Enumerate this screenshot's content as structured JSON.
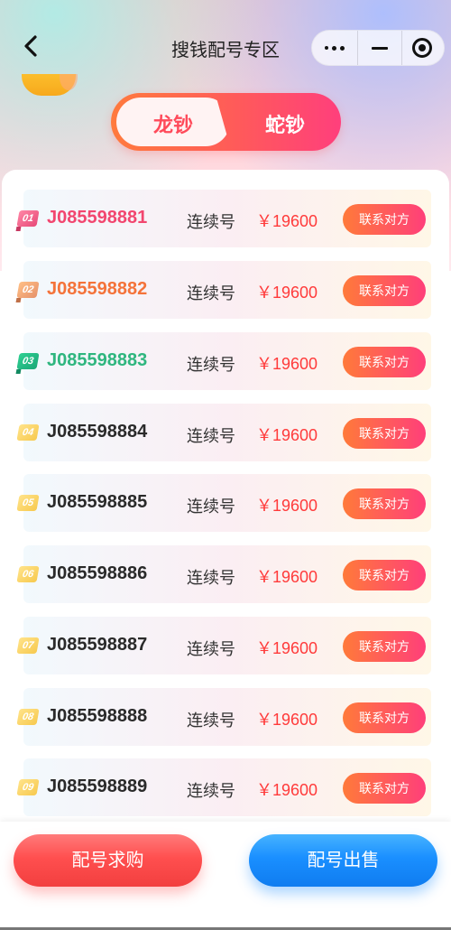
{
  "nav": {
    "title": "搜钱配号专区"
  },
  "tabs": [
    {
      "label": "龙钞",
      "active": true
    },
    {
      "label": "蛇钞",
      "active": false
    }
  ],
  "list": {
    "rows": [
      {
        "rank": "01",
        "number": "J085598881",
        "type": "连续号",
        "price": "￥19600",
        "action": "联系对方"
      },
      {
        "rank": "02",
        "number": "J085598882",
        "type": "连续号",
        "price": "￥19600",
        "action": "联系对方"
      },
      {
        "rank": "03",
        "number": "J085598883",
        "type": "连续号",
        "price": "￥19600",
        "action": "联系对方"
      },
      {
        "rank": "04",
        "number": "J085598884",
        "type": "连续号",
        "price": "￥19600",
        "action": "联系对方"
      },
      {
        "rank": "05",
        "number": "J085598885",
        "type": "连续号",
        "price": "￥19600",
        "action": "联系对方"
      },
      {
        "rank": "06",
        "number": "J085598886",
        "type": "连续号",
        "price": "￥19600",
        "action": "联系对方"
      },
      {
        "rank": "07",
        "number": "J085598887",
        "type": "连续号",
        "price": "￥19600",
        "action": "联系对方"
      },
      {
        "rank": "08",
        "number": "J085598888",
        "type": "连续号",
        "price": "￥19600",
        "action": "联系对方"
      },
      {
        "rank": "09",
        "number": "J085598889",
        "type": "连续号",
        "price": "￥19600",
        "action": "联系对方"
      }
    ]
  },
  "bottom": {
    "buy_label": "配号求购",
    "sell_label": "配号出售"
  },
  "colors": {
    "accent_red": "#ff3a3a",
    "rank1": "#f2466f",
    "rank2": "#f4733a",
    "rank3": "#2fb67f",
    "sell_blue": "#1a8fff"
  },
  "icons": {
    "back": "chevron-left-icon",
    "more": "more-dots-icon",
    "minimize": "minus-icon",
    "close": "target-circle-icon",
    "crown": "crown-icon"
  }
}
